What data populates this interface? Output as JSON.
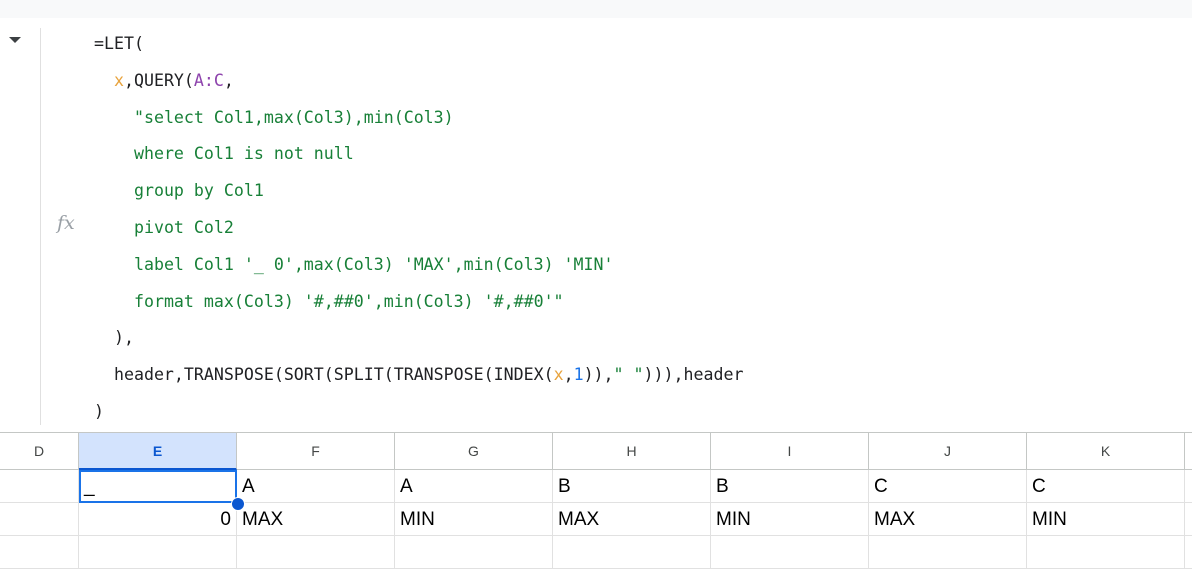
{
  "formula_bar": {
    "fx_icon": "fx",
    "lines": [
      [
        {
          "t": "=LET(",
          "c": "p"
        }
      ],
      [
        {
          "t": "  ",
          "c": "p"
        },
        {
          "t": "x",
          "c": "var"
        },
        {
          "t": ",QUERY(",
          "c": "fn"
        },
        {
          "t": "A:C",
          "c": "rng"
        },
        {
          "t": ",",
          "c": "p"
        }
      ],
      [
        {
          "t": "    ",
          "c": "p"
        },
        {
          "t": "\"select Col1,max(Col3),min(Col3)",
          "c": "str"
        }
      ],
      [
        {
          "t": "    ",
          "c": "p"
        },
        {
          "t": "where Col1 is not null",
          "c": "str"
        }
      ],
      [
        {
          "t": "    ",
          "c": "p"
        },
        {
          "t": "group by Col1",
          "c": "str"
        }
      ],
      [
        {
          "t": "    ",
          "c": "p"
        },
        {
          "t": "pivot Col2",
          "c": "str"
        }
      ],
      [
        {
          "t": "    ",
          "c": "p"
        },
        {
          "t": "label Col1 '_ 0',max(Col3) 'MAX',min(Col3) 'MIN'",
          "c": "str"
        }
      ],
      [
        {
          "t": "    ",
          "c": "p"
        },
        {
          "t": "format max(Col3) '#,##0',min(Col3) '#,##0'\"",
          "c": "str"
        }
      ],
      [
        {
          "t": "  ),",
          "c": "p"
        }
      ],
      [
        {
          "t": "  header,TRANSPOSE(SORT(SPLIT(TRANSPOSE(INDEX(",
          "c": "fn"
        },
        {
          "t": "x",
          "c": "var"
        },
        {
          "t": ",",
          "c": "p"
        },
        {
          "t": "1",
          "c": "num"
        },
        {
          "t": ")),",
          "c": "p"
        },
        {
          "t": "\" \"",
          "c": "str"
        },
        {
          "t": "))),header",
          "c": "p"
        }
      ],
      [
        {
          "t": ")",
          "c": "p"
        }
      ]
    ]
  },
  "grid": {
    "columns": [
      "D",
      "E",
      "F",
      "G",
      "H",
      "I",
      "J",
      "K"
    ],
    "selected_column": "E",
    "rows": [
      [
        "",
        "_",
        "A",
        "A",
        "B",
        "B",
        "C",
        "C"
      ],
      [
        "",
        "0",
        "MAX",
        "MIN",
        "MAX",
        "MIN",
        "MAX",
        "MIN"
      ]
    ]
  }
}
